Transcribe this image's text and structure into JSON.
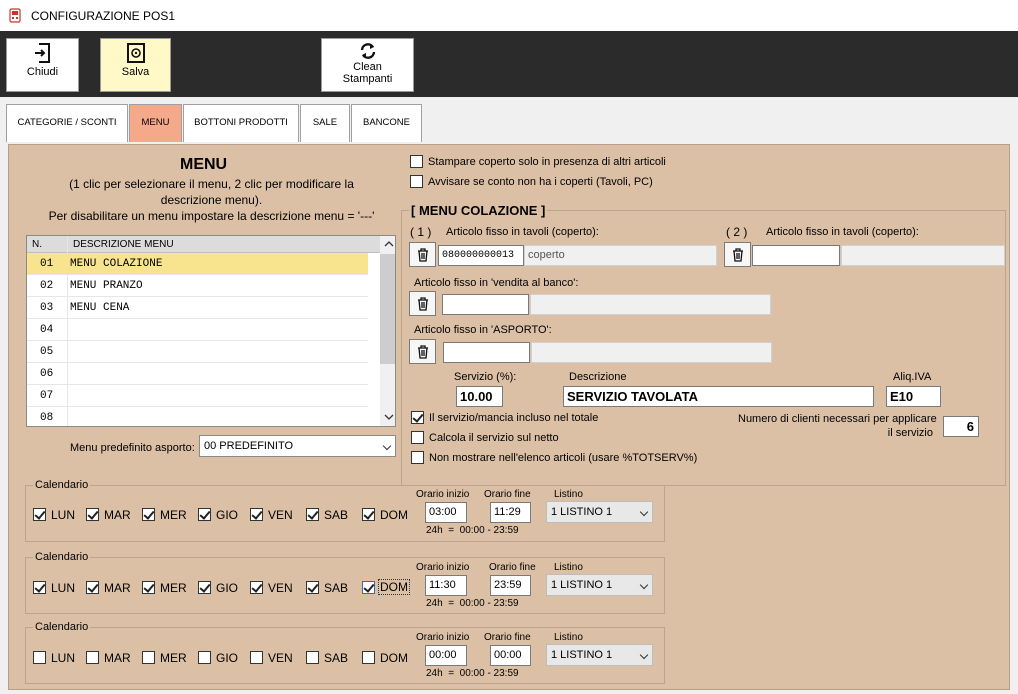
{
  "window": {
    "title": "CONFIGURAZIONE POS1"
  },
  "toolbar": {
    "close_label": "Chiudi",
    "save_label": "Salva",
    "clean_label_1": "Clean",
    "clean_label_2": "Stampanti"
  },
  "tabs": [
    "CATEGORIE / SCONTI",
    "MENU",
    "BOTTONI PRODOTTI",
    "SALE",
    "BANCONE"
  ],
  "menu_section": {
    "title": "MENU",
    "hint_1": "(1 clic per selezionare il menu, 2 clic per modificare la",
    "hint_2": "descrizione menu).",
    "hint_3": "Per disabilitare un menu impostare la descrizione menu = '---'",
    "col_n": "N.",
    "col_desc": "DESCRIZIONE MENU",
    "rows": [
      {
        "n": "01",
        "desc": "MENU COLAZIONE"
      },
      {
        "n": "02",
        "desc": "MENU PRANZO"
      },
      {
        "n": "03",
        "desc": "MENU CENA"
      },
      {
        "n": "04",
        "desc": ""
      },
      {
        "n": "05",
        "desc": ""
      },
      {
        "n": "06",
        "desc": ""
      },
      {
        "n": "07",
        "desc": ""
      },
      {
        "n": "08",
        "desc": ""
      }
    ],
    "default_label": "Menu predefinito asporto:",
    "default_value": "00 PREDEFINITO"
  },
  "options": {
    "stampare_coperto": "Stampare coperto solo in presenza di altri articoli",
    "avvisare_conto": "Avvisare se conto non ha i coperti (Tavoli, PC)"
  },
  "breakfast": {
    "title": "[ MENU COLAZIONE ]",
    "num1": "( 1 )",
    "num2": "( 2 )",
    "art_tavoli_label": "Articolo fisso in tavoli (coperto):",
    "art_tavoli_label_2": "Articolo fisso in tavoli (coperto):",
    "code1": "080000000013",
    "desc1": "coperto",
    "code2": "",
    "desc2": "",
    "vendita_label": "Articolo fisso in 'vendita al banco':",
    "vendita_code": "",
    "asporto_label": "Articolo fisso in 'ASPORTO':",
    "asporto_code": "",
    "servizio_label": "Servizio (%):",
    "servizio_value": "10.00",
    "descrizione_label": "Descrizione",
    "descrizione_value": "SERVIZIO TAVOLATA",
    "iva_label": "Aliq.IVA",
    "iva_value": "E10",
    "incluso_label": "Il servizio/mancia incluso nel totale",
    "calcola_label": "Calcola il servizio sul netto",
    "non_mostrare_label": "Non mostrare nell'elenco articoli (usare %TOTSERV%)",
    "clienti_label_1": "Numero di clienti necessari per applicare",
    "clienti_label_2": "il servizio",
    "clienti_value": "6"
  },
  "calendars": [
    {
      "title": "Calendario",
      "days": [
        "LUN",
        "MAR",
        "MER",
        "GIO",
        "VEN",
        "SAB",
        "DOM"
      ],
      "checked": [
        true,
        true,
        true,
        true,
        true,
        true,
        true
      ],
      "start_label": "Orario inizio",
      "start": "03:00",
      "end_label": "Orario fine",
      "end": "11:29",
      "listino_label": "Listino",
      "listino": "1 LISTINO 1",
      "note": "24h  =  00:00 - 23:59"
    },
    {
      "title": "Calendario",
      "days": [
        "LUN",
        "MAR",
        "MER",
        "GIO",
        "VEN",
        "SAB",
        "DOM"
      ],
      "checked": [
        true,
        true,
        true,
        true,
        true,
        true,
        true
      ],
      "start_label": "Orario inizio",
      "start": "11:30",
      "end_label": "Orario fine",
      "end": "23:59",
      "listino_label": "Listino",
      "listino": "1 LISTINO 1",
      "note": "24h  =  00:00 - 23:59"
    },
    {
      "title": "Calendario",
      "days": [
        "LUN",
        "MAR",
        "MER",
        "GIO",
        "VEN",
        "SAB",
        "DOM"
      ],
      "checked": [
        false,
        false,
        false,
        false,
        false,
        false,
        false
      ],
      "start_label": "Orario inizio",
      "start": "00:00",
      "end_label": "Orario fine",
      "end": "00:00",
      "listino_label": "Listino",
      "listino": "1 LISTINO 1",
      "note": "24h  =  00:00 - 23:59"
    }
  ]
}
